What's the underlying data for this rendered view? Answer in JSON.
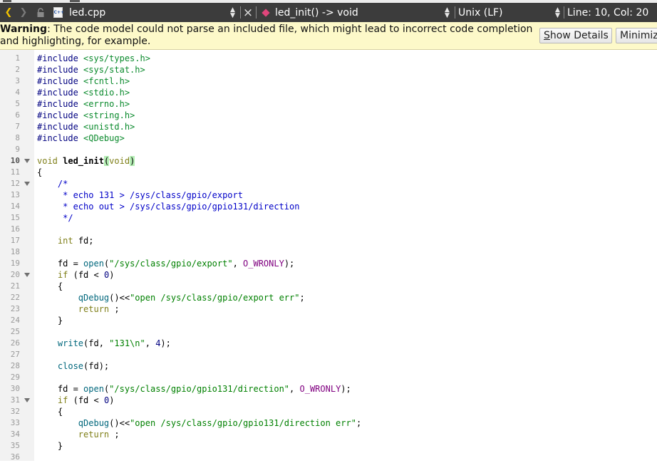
{
  "toolbar": {
    "back_glyph": "❮",
    "forward_glyph": "❯",
    "file_name": "led.cpp",
    "file_type_badge": "C++",
    "symbol": "led_init() -> void",
    "line_endings": "Unix (LF)",
    "cursor_position": "Line: 10, Col: 20",
    "close_glyph": "×"
  },
  "warning": {
    "label": "Warning",
    "message": ": The code model could not parse an included file, which might lead to incorrect code completion and highlighting, for example.",
    "show_details_mnemonic": "S",
    "show_details_rest": "how Details",
    "minimize": "Minimize"
  },
  "editor": {
    "current_line": 10,
    "lines": [
      {
        "n": "1",
        "fold": false,
        "segs": [
          {
            "c": "pp",
            "t": "#include "
          },
          {
            "c": "inc",
            "t": "<sys/types.h>"
          }
        ]
      },
      {
        "n": "2",
        "fold": false,
        "segs": [
          {
            "c": "pp",
            "t": "#include "
          },
          {
            "c": "inc",
            "t": "<sys/stat.h>"
          }
        ]
      },
      {
        "n": "3",
        "fold": false,
        "segs": [
          {
            "c": "pp",
            "t": "#include "
          },
          {
            "c": "inc",
            "t": "<fcntl.h>"
          }
        ]
      },
      {
        "n": "4",
        "fold": false,
        "segs": [
          {
            "c": "pp",
            "t": "#include "
          },
          {
            "c": "inc",
            "t": "<stdio.h>"
          }
        ]
      },
      {
        "n": "5",
        "fold": false,
        "segs": [
          {
            "c": "pp",
            "t": "#include "
          },
          {
            "c": "inc",
            "t": "<errno.h>"
          }
        ]
      },
      {
        "n": "6",
        "fold": false,
        "segs": [
          {
            "c": "pp",
            "t": "#include "
          },
          {
            "c": "inc",
            "t": "<string.h>"
          }
        ]
      },
      {
        "n": "7",
        "fold": false,
        "segs": [
          {
            "c": "pp",
            "t": "#include "
          },
          {
            "c": "inc",
            "t": "<unistd.h>"
          }
        ]
      },
      {
        "n": "8",
        "fold": false,
        "segs": [
          {
            "c": "pp",
            "t": "#include "
          },
          {
            "c": "inc",
            "t": "<QDebug>"
          }
        ]
      },
      {
        "n": "9",
        "fold": false,
        "segs": []
      },
      {
        "n": "10",
        "fold": true,
        "segs": [
          {
            "c": "kw",
            "t": "void "
          },
          {
            "c": "def",
            "t": "led_init"
          },
          {
            "c": "paren",
            "t": "("
          },
          {
            "c": "kw",
            "t": "void"
          },
          {
            "c": "paren",
            "t": ")"
          }
        ]
      },
      {
        "n": "11",
        "fold": false,
        "segs": [
          {
            "c": "tx",
            "t": "{"
          }
        ]
      },
      {
        "n": "12",
        "fold": true,
        "segs": [
          {
            "c": "cm",
            "t": "    /*"
          }
        ]
      },
      {
        "n": "13",
        "fold": false,
        "segs": [
          {
            "c": "cm",
            "t": "     * echo 131 > /sys/class/gpio/export"
          }
        ]
      },
      {
        "n": "14",
        "fold": false,
        "segs": [
          {
            "c": "cm",
            "t": "     * echo out > /sys/class/gpio/gpio131/direction"
          }
        ]
      },
      {
        "n": "15",
        "fold": false,
        "segs": [
          {
            "c": "cm",
            "t": "     */"
          }
        ]
      },
      {
        "n": "16",
        "fold": false,
        "segs": []
      },
      {
        "n": "17",
        "fold": false,
        "segs": [
          {
            "c": "tx",
            "t": "    "
          },
          {
            "c": "kw",
            "t": "int "
          },
          {
            "c": "tx",
            "t": "fd;"
          }
        ]
      },
      {
        "n": "18",
        "fold": false,
        "segs": []
      },
      {
        "n": "19",
        "fold": false,
        "segs": [
          {
            "c": "tx",
            "t": "    fd = "
          },
          {
            "c": "fn",
            "t": "open"
          },
          {
            "c": "tx",
            "t": "("
          },
          {
            "c": "str",
            "t": "\"/sys/class/gpio/export\""
          },
          {
            "c": "tx",
            "t": ", "
          },
          {
            "c": "macro",
            "t": "O_WRONLY"
          },
          {
            "c": "tx",
            "t": ");"
          }
        ]
      },
      {
        "n": "20",
        "fold": true,
        "segs": [
          {
            "c": "tx",
            "t": "    "
          },
          {
            "c": "kw",
            "t": "if "
          },
          {
            "c": "tx",
            "t": "(fd < "
          },
          {
            "c": "num",
            "t": "0"
          },
          {
            "c": "tx",
            "t": ")"
          }
        ]
      },
      {
        "n": "21",
        "fold": false,
        "segs": [
          {
            "c": "tx",
            "t": "    {"
          }
        ]
      },
      {
        "n": "22",
        "fold": false,
        "segs": [
          {
            "c": "tx",
            "t": "        "
          },
          {
            "c": "fn",
            "t": "qDebug"
          },
          {
            "c": "tx",
            "t": "()<<"
          },
          {
            "c": "str",
            "t": "\"open /sys/class/gpio/export err\""
          },
          {
            "c": "tx",
            "t": ";"
          }
        ]
      },
      {
        "n": "23",
        "fold": false,
        "segs": [
          {
            "c": "tx",
            "t": "        "
          },
          {
            "c": "kw",
            "t": "return "
          },
          {
            "c": "tx",
            "t": ";"
          }
        ]
      },
      {
        "n": "24",
        "fold": false,
        "segs": [
          {
            "c": "tx",
            "t": "    }"
          }
        ]
      },
      {
        "n": "25",
        "fold": false,
        "segs": []
      },
      {
        "n": "26",
        "fold": false,
        "segs": [
          {
            "c": "tx",
            "t": "    "
          },
          {
            "c": "fn",
            "t": "write"
          },
          {
            "c": "tx",
            "t": "(fd, "
          },
          {
            "c": "str",
            "t": "\"131\\n\""
          },
          {
            "c": "tx",
            "t": ", "
          },
          {
            "c": "num",
            "t": "4"
          },
          {
            "c": "tx",
            "t": ");"
          }
        ]
      },
      {
        "n": "27",
        "fold": false,
        "segs": []
      },
      {
        "n": "28",
        "fold": false,
        "segs": [
          {
            "c": "tx",
            "t": "    "
          },
          {
            "c": "fn",
            "t": "close"
          },
          {
            "c": "tx",
            "t": "(fd);"
          }
        ]
      },
      {
        "n": "29",
        "fold": false,
        "segs": []
      },
      {
        "n": "30",
        "fold": false,
        "segs": [
          {
            "c": "tx",
            "t": "    fd = "
          },
          {
            "c": "fn",
            "t": "open"
          },
          {
            "c": "tx",
            "t": "("
          },
          {
            "c": "str",
            "t": "\"/sys/class/gpio/gpio131/direction\""
          },
          {
            "c": "tx",
            "t": ", "
          },
          {
            "c": "macro",
            "t": "O_WRONLY"
          },
          {
            "c": "tx",
            "t": ");"
          }
        ]
      },
      {
        "n": "31",
        "fold": true,
        "segs": [
          {
            "c": "tx",
            "t": "    "
          },
          {
            "c": "kw",
            "t": "if "
          },
          {
            "c": "tx",
            "t": "(fd < "
          },
          {
            "c": "num",
            "t": "0"
          },
          {
            "c": "tx",
            "t": ")"
          }
        ]
      },
      {
        "n": "32",
        "fold": false,
        "segs": [
          {
            "c": "tx",
            "t": "    {"
          }
        ]
      },
      {
        "n": "33",
        "fold": false,
        "segs": [
          {
            "c": "tx",
            "t": "        "
          },
          {
            "c": "fn",
            "t": "qDebug"
          },
          {
            "c": "tx",
            "t": "()<<"
          },
          {
            "c": "str",
            "t": "\"open /sys/class/gpio/gpio131/direction err\""
          },
          {
            "c": "tx",
            "t": ";"
          }
        ]
      },
      {
        "n": "34",
        "fold": false,
        "segs": [
          {
            "c": "tx",
            "t": "        "
          },
          {
            "c": "kw",
            "t": "return "
          },
          {
            "c": "tx",
            "t": ";"
          }
        ]
      },
      {
        "n": "35",
        "fold": false,
        "segs": [
          {
            "c": "tx",
            "t": "    }"
          }
        ]
      },
      {
        "n": "36",
        "fold": false,
        "segs": []
      }
    ]
  }
}
